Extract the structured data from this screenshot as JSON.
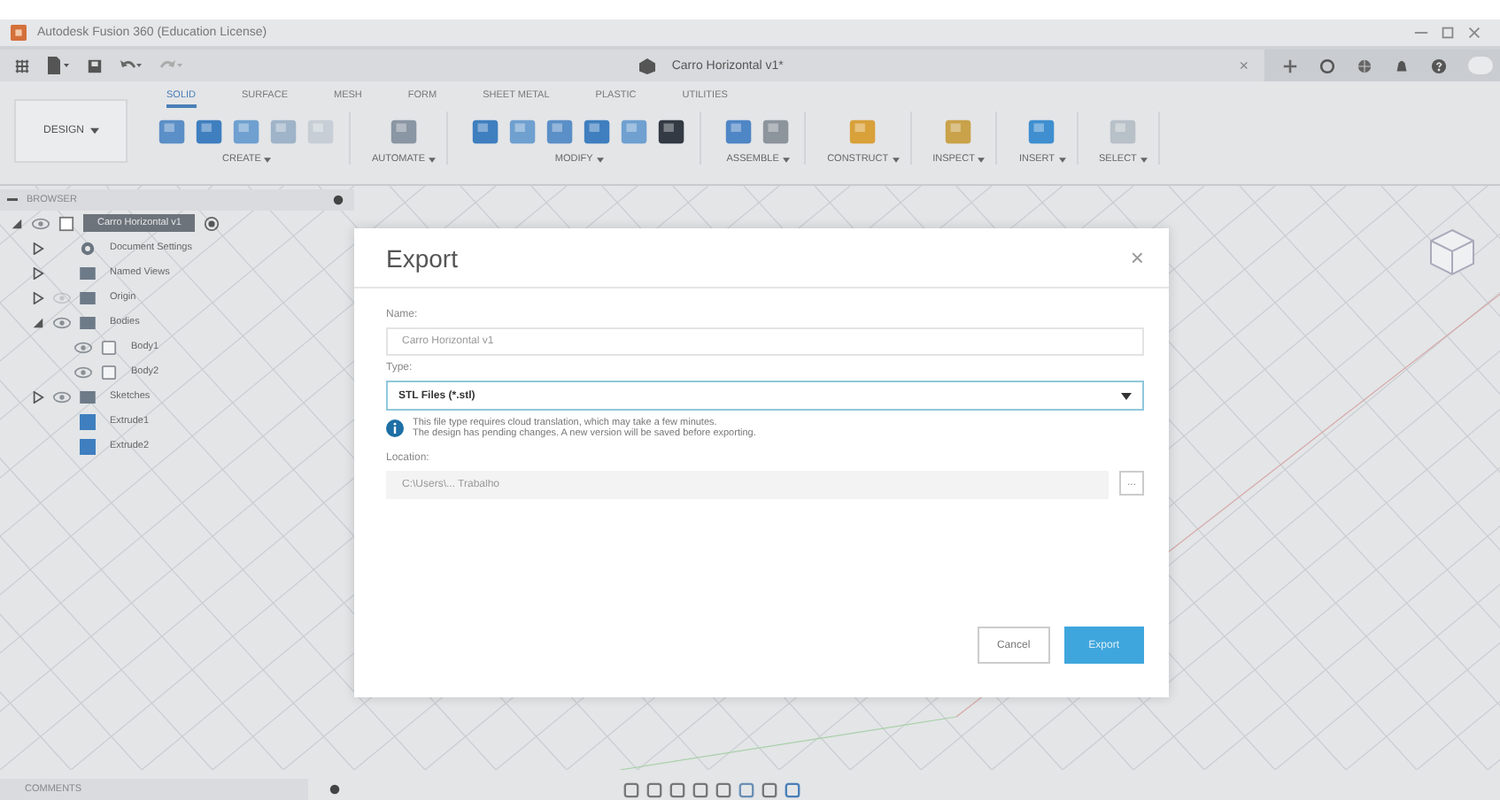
{
  "window": {
    "title": "Autodesk Fusion 360 (Education License)"
  },
  "document_tab": {
    "title": "Carro Horizontal v1*",
    "close": "×"
  },
  "ribbon": {
    "workspace": "DESIGN",
    "tabs": [
      {
        "label": "SOLID",
        "selected": true
      },
      {
        "label": "SURFACE",
        "selected": false
      },
      {
        "label": "MESH",
        "selected": false
      },
      {
        "label": "FORM",
        "selected": false
      },
      {
        "label": "SHEET METAL",
        "selected": false
      },
      {
        "label": "PLASTIC",
        "selected": false
      },
      {
        "label": "UTILITIES",
        "selected": false
      }
    ],
    "groups": [
      {
        "label": "CREATE"
      },
      {
        "label": "AUTOMATE"
      },
      {
        "label": "MODIFY"
      },
      {
        "label": "ASSEMBLE"
      },
      {
        "label": "CONSTRUCT"
      },
      {
        "label": "INSPECT"
      },
      {
        "label": "INSERT"
      },
      {
        "label": "SELECT"
      }
    ]
  },
  "browser": {
    "title": "BROWSER",
    "tree": [
      {
        "label": "Carro Horizontal v1",
        "kind": "component",
        "expanded": true,
        "visible": true,
        "selected": true,
        "children": [
          {
            "label": "Document Settings",
            "kind": "settings",
            "expanded": false,
            "selected": false
          },
          {
            "label": "Named Views",
            "kind": "folder",
            "expanded": false,
            "selected": false
          },
          {
            "label": "Origin",
            "kind": "folder",
            "expanded": false,
            "visible": false,
            "selected": false
          },
          {
            "label": "Bodies",
            "kind": "folder",
            "expanded": true,
            "visible": true,
            "selected": false,
            "children": [
              {
                "label": "Body1",
                "kind": "body",
                "visible": true,
                "selected": false
              },
              {
                "label": "Body2",
                "kind": "body",
                "visible": true,
                "selected": false
              }
            ]
          },
          {
            "label": "Sketches",
            "kind": "folder",
            "expanded": false,
            "visible": true,
            "selected": false
          },
          {
            "label": "Extrude1",
            "kind": "feature",
            "selected": false
          },
          {
            "label": "Extrude2",
            "kind": "feature",
            "selected": false
          }
        ]
      }
    ]
  },
  "dialog": {
    "title": "Export",
    "close": "×",
    "name_label": "Name:",
    "name_value": "Carro Horizontal v1",
    "type_label": "Type:",
    "type_value": "STL Files (*.stl)",
    "info": [
      "This file type requires cloud translation, which may take a few minutes.",
      "The design has pending changes. A new version will be saved before exporting."
    ],
    "location_label": "Location:",
    "location_value": "C:\\Users\\... Trabalho",
    "browse": "...",
    "buttons": [
      {
        "label": "Cancel",
        "kind": "secondary"
      },
      {
        "label": "Export",
        "kind": "primary"
      }
    ]
  },
  "comments": {
    "title": "COMMENTS"
  }
}
